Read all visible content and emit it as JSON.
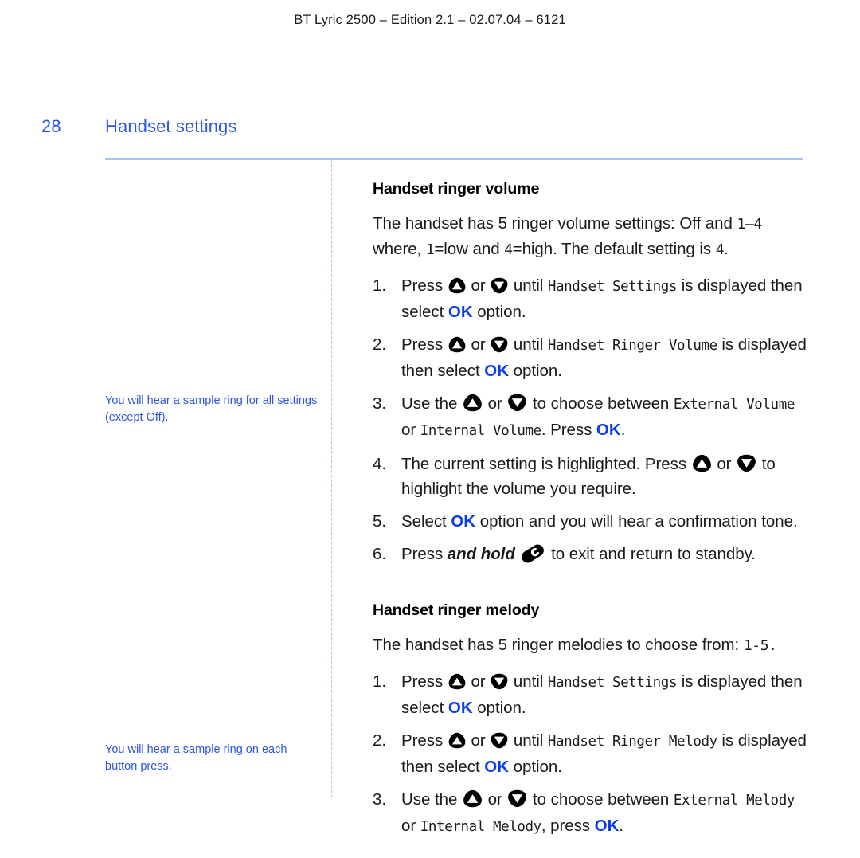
{
  "document": {
    "running_header": "BT Lyric 2500 – Edition 2.1 – 02.07.04 – 6121",
    "page_number": "28",
    "section_title": "Handset settings"
  },
  "colors": {
    "brand_blue": "#2B55E8",
    "ok_blue": "#0A3CEF",
    "rule_blue": "#A8C4F4",
    "body_black": "#1a1a1a"
  },
  "sidenotes": [
    {
      "id": "sample-ring-all-settings",
      "text": "You will hear a sample ring for all settings (except Off)."
    },
    {
      "id": "sample-ring-each-press",
      "text": "You will hear a sample ring on each button press."
    }
  ],
  "sections": [
    {
      "id": "handset-ringer-volume",
      "heading": "Handset ringer volume",
      "intro_line_1": "The handset has 5 ringer volume settings: Off and ",
      "intro_lcd_1": "1–4",
      "intro_line_2_a": "where, ",
      "intro_lcd_2a": "1",
      "intro_line_2_b": "=low and ",
      "intro_lcd_2b": "4",
      "intro_line_2_c": "=high. The default setting is ",
      "intro_lcd_2c": "4",
      "intro_line_2_d": ".",
      "steps": [
        {
          "number": "1.",
          "a": "Press ",
          "icon_up": "up-arrow-key-icon",
          "b": " or ",
          "icon_down": "down-arrow-key-icon",
          "c": " until ",
          "lcd": "Handset Settings",
          "d": " is displayed then select ",
          "ok": "OK",
          "e": " option."
        },
        {
          "number": "2.",
          "a": "Press ",
          "icon_up": "up-arrow-key-icon",
          "b": " or ",
          "icon_down": "down-arrow-key-icon",
          "c": " until ",
          "lcd": "Handset Ringer Volume",
          "d": " is displayed then select ",
          "ok": "OK",
          "e": " option."
        },
        {
          "number": "3.",
          "a": "Use the ",
          "icon_up": "up-arrow-key-icon",
          "b": " or ",
          "icon_down": "down-arrow-key-icon",
          "c": " to choose between ",
          "lcd": "External Volume",
          "d": " or ",
          "lcd2": "Internal Volume",
          "e": ". Press ",
          "ok": "OK",
          "f": "."
        },
        {
          "number": "4.",
          "a": "The current setting is highlighted. Press ",
          "icon_up": "up-arrow-key-icon",
          "b": " or ",
          "icon_down": "down-arrow-key-icon",
          "c": " to highlight the volume you require."
        },
        {
          "number": "5.",
          "a": "Select ",
          "ok": "OK",
          "b": " option and you will hear a confirmation tone."
        },
        {
          "number": "6.",
          "a": "Press ",
          "emphasis": "and hold",
          "icon_end": "end-call-key-icon",
          "b": " to exit and return to standby."
        }
      ]
    },
    {
      "id": "handset-ringer-melody",
      "heading": "Handset ringer melody",
      "intro_line_1": "The handset has 5 ringer melodies to choose from: ",
      "intro_lcd_1": "1-5.",
      "steps": [
        {
          "number": "1.",
          "a": "Press ",
          "icon_up": "up-arrow-key-icon",
          "b": " or ",
          "icon_down": "down-arrow-key-icon",
          "c": " until ",
          "lcd": "Handset Settings",
          "d": " is displayed then select ",
          "ok": "OK",
          "e": " option."
        },
        {
          "number": "2.",
          "a": "Press ",
          "icon_up": "up-arrow-key-icon",
          "b": " or ",
          "icon_down": "down-arrow-key-icon",
          "c": " until ",
          "lcd": "Handset Ringer Melody",
          "d": " is displayed then select ",
          "ok": "OK",
          "e": " option."
        },
        {
          "number": "3.",
          "a": "Use the ",
          "icon_up": "up-arrow-key-icon",
          "b": " or ",
          "icon_down": "down-arrow-key-icon",
          "c": " to choose between ",
          "lcd": "External Melody",
          "d": " or ",
          "lcd2": "Internal Melody",
          "e": ", press ",
          "ok": "OK",
          "f": "."
        }
      ]
    }
  ]
}
